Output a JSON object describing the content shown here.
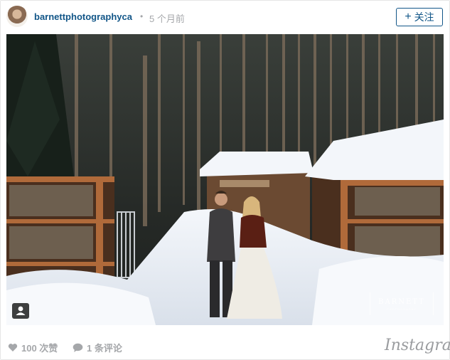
{
  "post": {
    "username": "barnettphotographyca",
    "separator": "•",
    "time_ago": "5 个月前",
    "follow_label": "关注",
    "follow_plus": "+",
    "likes": "100 次赞",
    "comments": "1 条评论",
    "logo": "Instagram"
  },
  "photo": {
    "watermark_brand": "BARNETT",
    "watermark_sub": "PHOTOGRAPHY",
    "user_tag_icon": "person-icon"
  },
  "colors": {
    "username": "#125688",
    "meta_gray": "#a5a7aa",
    "follow_border": "#125688"
  }
}
